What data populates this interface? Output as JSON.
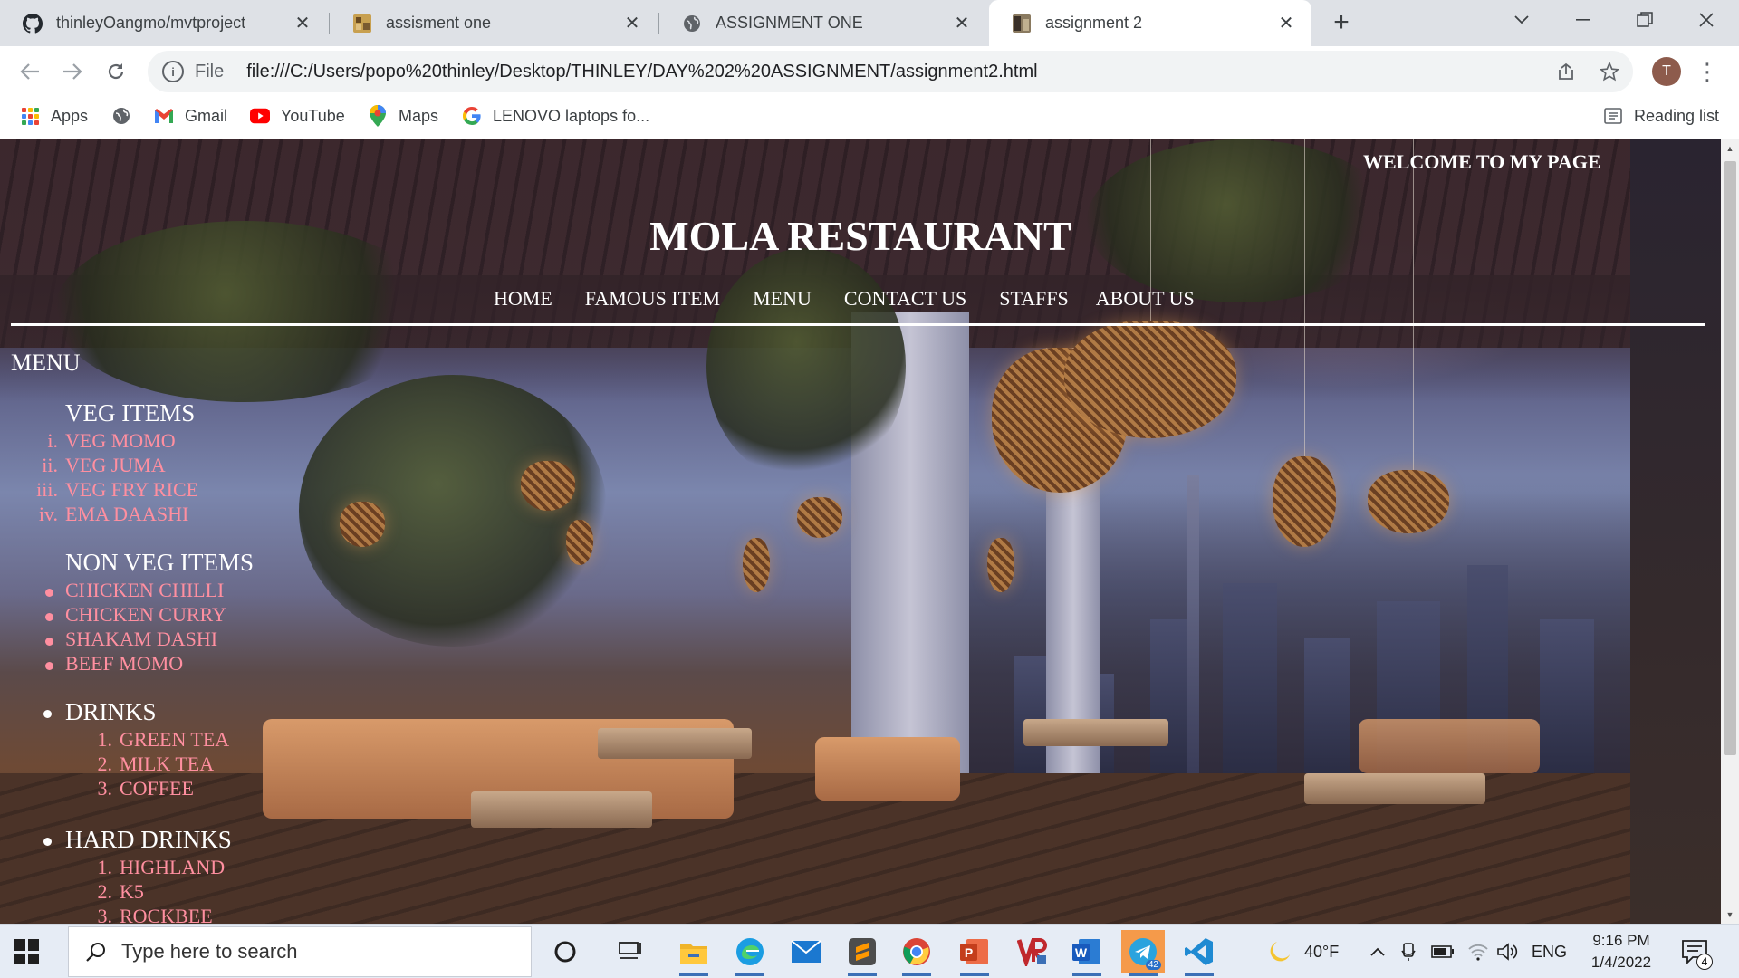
{
  "browser": {
    "tabs": [
      {
        "title": "thinleyOangmo/mvtproject",
        "icon": "github-icon",
        "active": false
      },
      {
        "title": "assisment one",
        "icon": "image-favicon-icon",
        "active": false
      },
      {
        "title": "ASSIGNMENT ONE",
        "icon": "globe-icon",
        "active": false
      },
      {
        "title": "assignment 2",
        "icon": "image-favicon-icon",
        "active": true
      }
    ],
    "close_glyph": "✕",
    "new_tab_glyph": "+",
    "address": {
      "scheme_label": "File",
      "url": "file:///C:/Users/popo%20thinley/Desktop/THINLEY/DAY%202%20ASSIGNMENT/assignment2.html"
    },
    "profile_initial": "T",
    "bookmarks": [
      {
        "label": "Apps",
        "icon": "apps-grid-icon"
      },
      {
        "label": "",
        "icon": "globe-icon"
      },
      {
        "label": "Gmail",
        "icon": "gmail-icon"
      },
      {
        "label": "YouTube",
        "icon": "youtube-icon"
      },
      {
        "label": "Maps",
        "icon": "maps-pin-icon"
      },
      {
        "label": "LENOVO laptops fo...",
        "icon": "google-g-icon"
      }
    ],
    "reading_list_label": "Reading list"
  },
  "page": {
    "welcome": "WELCOME TO MY PAGE",
    "title": "MOLA RESTAURANT",
    "nav": [
      "HOME",
      "FAMOUS ITEM",
      "MENU",
      "CONTACT US",
      "STAFFS",
      "ABOUT US"
    ],
    "menu_heading": "MENU",
    "sections": [
      {
        "title": "VEG ITEMS",
        "markers": [
          "i.",
          "ii.",
          "iii.",
          "iv."
        ],
        "items": [
          "VEG MOMO",
          "VEG JUMA",
          "VEG FRY RICE",
          "EMA DAASHI"
        ]
      },
      {
        "title": "NON VEG ITEMS",
        "items": [
          "CHICKEN CHILLI",
          "CHICKEN CURRY",
          "SHAKAM DASHI",
          "BEEF MOMO"
        ]
      },
      {
        "title": "DRINKS",
        "markers": [
          "1.",
          "2.",
          "3."
        ],
        "items": [
          "GREEN TEA",
          "MILK TEA",
          "COFFEE"
        ]
      },
      {
        "title": "HARD DRINKS",
        "markers": [
          "1.",
          "2.",
          "3."
        ],
        "items": [
          "HIGHLAND",
          "K5",
          "ROCKBEE"
        ]
      }
    ],
    "colors": {
      "item_text": "#ff8fa0",
      "heading_text": "#ffffff"
    }
  },
  "taskbar": {
    "search_placeholder": "Type here to search",
    "apps": [
      "cortana-icon",
      "task-view-icon",
      "file-explorer-icon",
      "edge-icon",
      "mail-icon",
      "sublime-text-icon",
      "chrome-icon",
      "powerpoint-icon",
      "vr-app-icon",
      "word-icon",
      "telegram-icon",
      "vscode-icon"
    ],
    "telegram_badge": "42",
    "weather": "40°F",
    "language": "ENG",
    "time": "9:16 PM",
    "date": "1/4/2022",
    "notification_count": "4"
  }
}
